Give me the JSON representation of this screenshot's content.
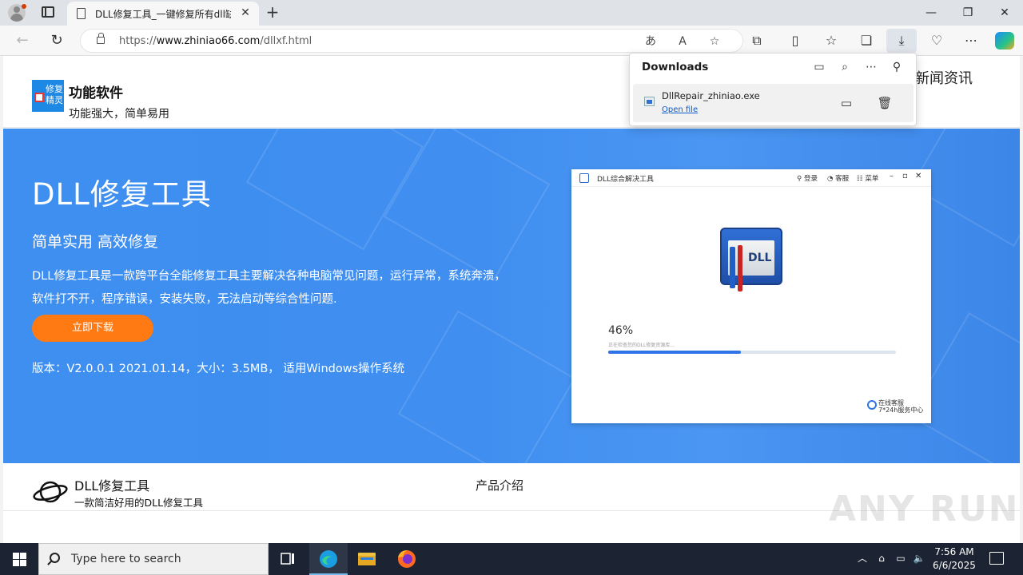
{
  "browser": {
    "tab_title": "DLL修复工具_一键修复所有dll缺",
    "tab_close": "✕",
    "new_tab": "+",
    "url_prefix": "https://",
    "url_host": "www.zhiniao66.com",
    "url_path": "/dllxf.html",
    "window_controls": {
      "minimize": "—",
      "maximize": "❐",
      "close": "✕"
    }
  },
  "downloads": {
    "title": "Downloads",
    "file_name": "DllRepair_zhiniao.exe",
    "open_file": "Open file"
  },
  "site": {
    "brand_name": "功能软件",
    "brand_sub": "功能强大，简单易用",
    "logo_line1": "修复",
    "logo_line2": "精灵",
    "nav_news": "新闻资讯",
    "hero": {
      "title": "DLL修复工具",
      "slogan": "简单实用 高效修复",
      "description": "DLL修复工具是一款跨平台全能修复工具主要解决各种电脑常见问题，运行异常，系统奔溃，软件打不开，程序错误，安装失败，无法启动等综合性问题.",
      "download_button": "立即下载",
      "version_info": "版本：V2.0.0.1 2021.01.14，大小：3.5MB， 适用Windows操作系统"
    },
    "app_screenshot": {
      "app_name": "DLL综合解决工具",
      "menu_login": "登录",
      "menu_service": "客服",
      "menu_menu": "菜单",
      "dll_label": "DLL",
      "progress_text": "46%",
      "progress_value": 0.46,
      "progress_subtext": "正在检查您的DLL修复资源库...",
      "brand_line1": "在线客服",
      "brand_line2": "7*24h服务中心"
    },
    "product": {
      "title": "DLL修复工具",
      "subtitle": "一款简洁好用的DLL修复工具",
      "nav_intro": "产品介绍"
    },
    "watermark": "ANY RUN"
  },
  "taskbar": {
    "search_placeholder": "Type here to search",
    "time": "7:56 AM",
    "date": "6/6/2025"
  },
  "colors": {
    "hero_blue": "#3e8ff0",
    "download_orange": "#ff7a12",
    "progress_blue": "#2e74e6",
    "taskbar": "#1c2433"
  }
}
